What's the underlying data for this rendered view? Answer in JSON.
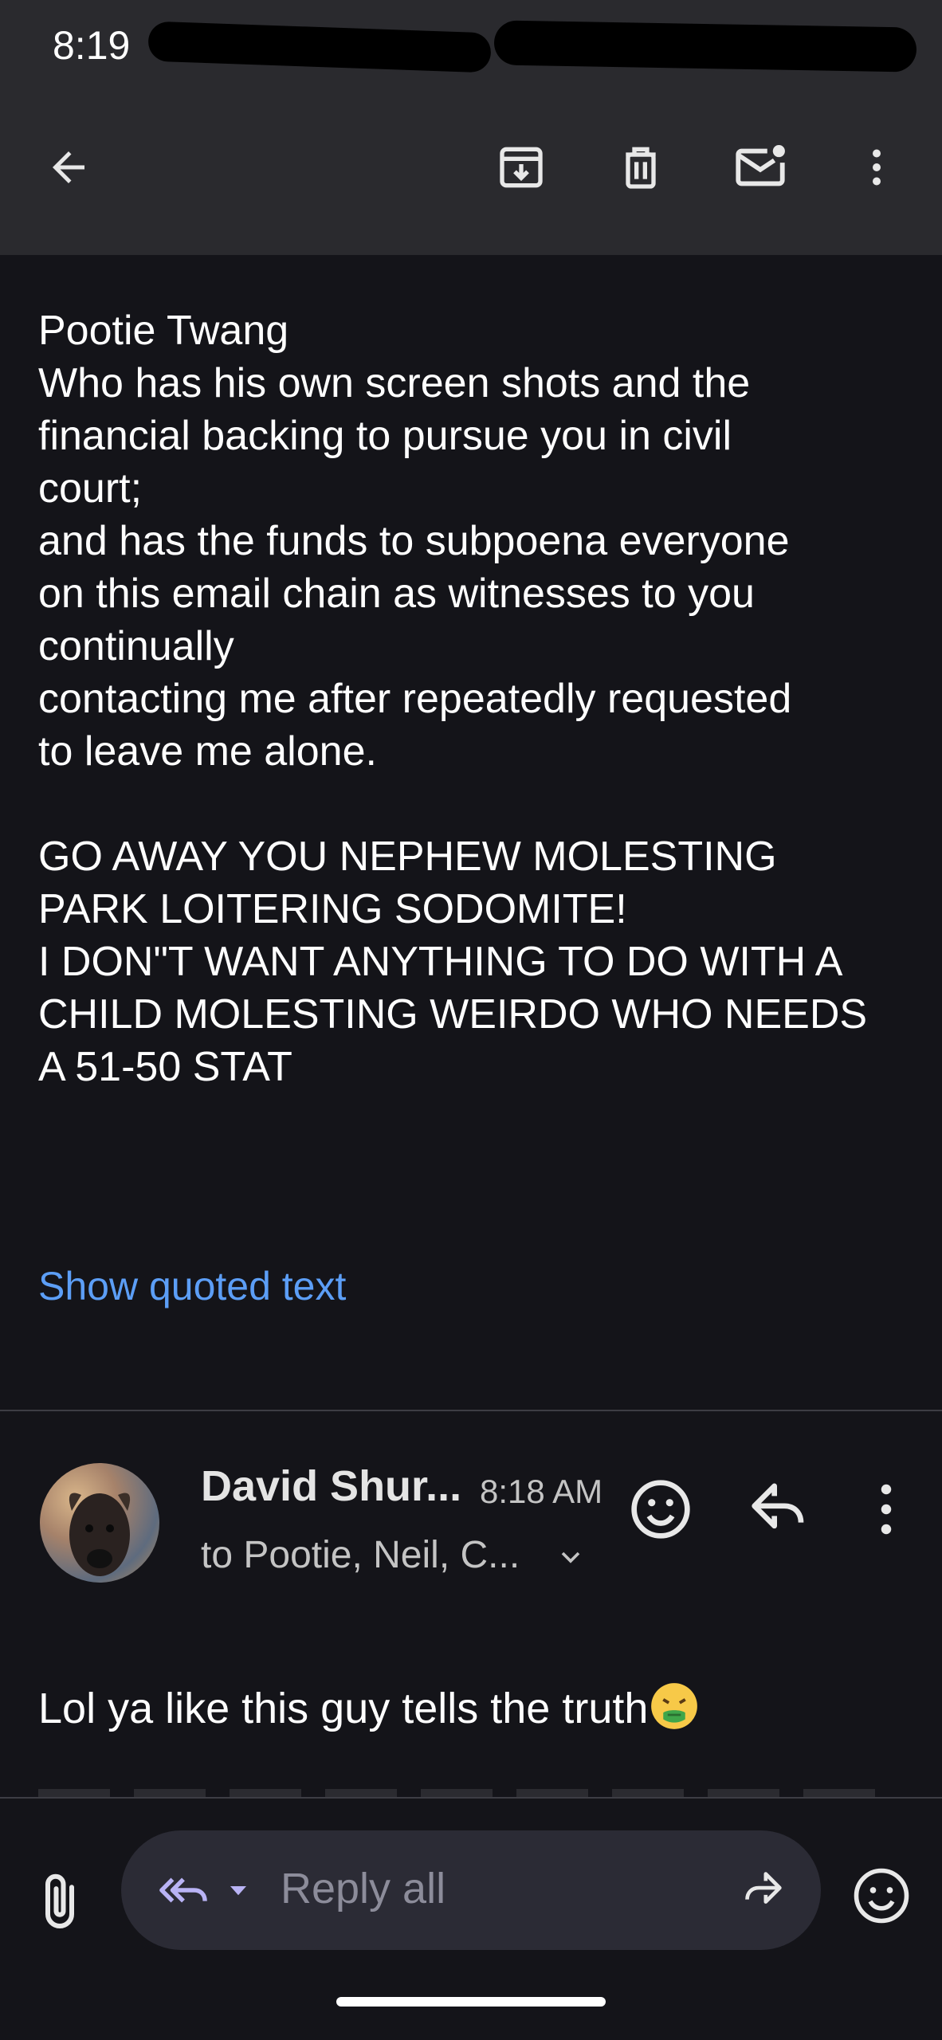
{
  "status_bar": {
    "time": "8:19"
  },
  "toolbar": {
    "back": "back-arrow-icon",
    "archive": "archive-icon",
    "delete": "trash-icon",
    "mark_unread": "mark-unread-icon",
    "more": "more-vert-icon"
  },
  "email": {
    "body": "Pootie Twang\nWho has his own screen shots and the\nfinancial backing to pursue you in civil\ncourt;\nand has the funds to subpoena everyone\non this email chain as witnesses to you\ncontinually\ncontacting me after repeatedly requested\nto leave me alone.\n\nGO AWAY YOU NEPHEW MOLESTING\nPARK LOITERING SODOMITE!\nI DON\"T WANT ANYTHING TO DO WITH A\nCHILD MOLESTING WEIRDO WHO NEEDS\nA 51-50 STAT",
    "show_quoted": "Show quoted text"
  },
  "next_message": {
    "sender": "David Shur...",
    "time": "8:18 AM",
    "recipients": "to Pootie, Neil, C...",
    "body": "Lol ya like this guy tells the truth"
  },
  "reply_bar": {
    "placeholder": "Reply all"
  },
  "colors": {
    "background": "#141419",
    "toolbar": "#2a2a2e",
    "link": "#5c9ef6",
    "pill": "#2b2b35"
  }
}
